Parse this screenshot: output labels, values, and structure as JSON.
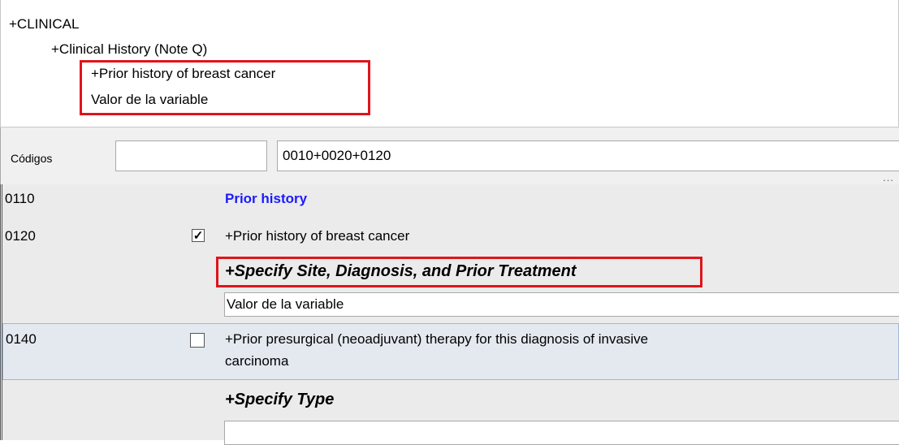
{
  "tree": {
    "level1": "+CLINICAL",
    "level2": "+Clinical History (Note Q)",
    "level3": "+Prior history of breast cancer",
    "level4": "Valor de la variable"
  },
  "codes_bar": {
    "label": "Códigos",
    "input1_value": "",
    "input2_value": "0010+0020+0120",
    "more": "..."
  },
  "items": [
    {
      "code": "0110",
      "text": "Prior history",
      "type": "header"
    },
    {
      "code": "0120",
      "text": "+Prior history of breast cancer",
      "checked": true,
      "specify_label": "+Specify Site, Diagnosis, and Prior Treatment",
      "value": "Valor de la variable"
    },
    {
      "code": "0140",
      "text_line1": "+Prior presurgical (neoadjuvant) therapy for this diagnosis of invasive",
      "text_line2": "carcinoma",
      "checked": false,
      "specify_label": "+Specify Type",
      "value": ""
    }
  ],
  "colors": {
    "highlight": "#e0141c",
    "link_blue": "#1a1aff",
    "panel_gray": "#ebebeb",
    "selected_row": "#e4e9f0"
  }
}
